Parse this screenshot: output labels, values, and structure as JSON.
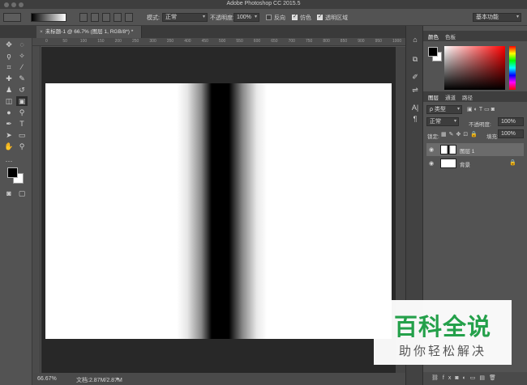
{
  "window": {
    "title": "Adobe Photoshop CC 2015.5"
  },
  "options_bar": {
    "mode_label": "模式:",
    "mode_value": "正常",
    "opacity_label": "不透明度:",
    "opacity_value": "100%",
    "reverse_label": "反向",
    "dither_label": "仿色",
    "transparency_label": "透明区域",
    "reverse_checked": false,
    "dither_checked": true,
    "transparency_checked": true,
    "workspace_value": "基本功能"
  },
  "document": {
    "tab_title": "未标题-1 @ 66.7% (图层 1, RGB/8*) *",
    "zoom": "66.67%",
    "doc_size": "文档:2.87M/2.87M"
  },
  "ruler": {
    "top_ticks": [
      "0",
      "50",
      "100",
      "150",
      "200",
      "250",
      "300",
      "350",
      "400",
      "450",
      "500",
      "550",
      "600",
      "650",
      "700",
      "750",
      "800",
      "850",
      "900",
      "950",
      "1000"
    ]
  },
  "color_panel": {
    "tab_color": "颜色",
    "tab_swatches": "色板"
  },
  "layers_panel": {
    "tabs": [
      "图层",
      "通道",
      "路径"
    ],
    "filter_label": "ρ 类型",
    "blend_mode": "正常",
    "opacity_label": "不透明度:",
    "opacity_value": "100%",
    "lock_label": "锁定:",
    "fill_label": "填充:",
    "fill_value": "100%",
    "layers": [
      {
        "name": "图层 1",
        "selected": true
      },
      {
        "name": "背景",
        "selected": false
      }
    ]
  },
  "watermark": {
    "title": "百科全说",
    "subtitle": "助你轻松解决"
  },
  "colors": {
    "accent": "#24a04a",
    "panel_bg": "#535353",
    "pasteboard": "#282828"
  }
}
